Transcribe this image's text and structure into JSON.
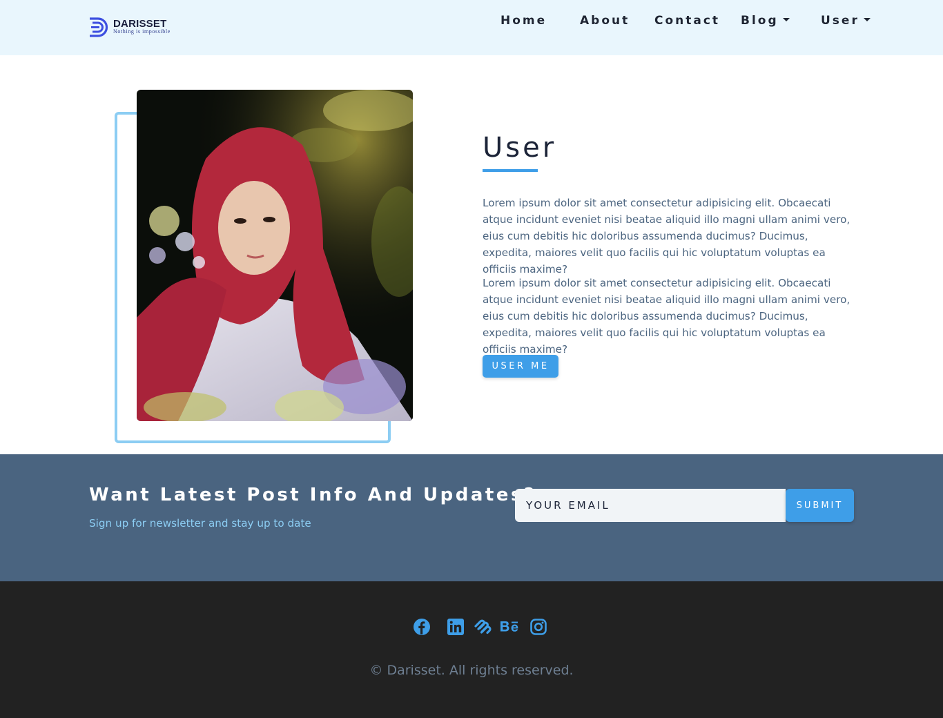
{
  "brand": {
    "name": "DARISSET",
    "tagline": "Nothing is impossible"
  },
  "nav": {
    "items": [
      {
        "label": "Home",
        "dropdown": false
      },
      {
        "label": "About",
        "dropdown": false
      },
      {
        "label": "Contact",
        "dropdown": false
      },
      {
        "label": "Blog",
        "dropdown": true
      },
      {
        "label": "User",
        "dropdown": true
      }
    ]
  },
  "about": {
    "title": "User",
    "paragraphs": [
      "Lorem ipsum dolor sit amet consectetur adipisicing elit. Obcaecati atque incidunt eveniet nisi beatae aliquid illo magni ullam animi vero, eius cum debitis hic doloribus assumenda ducimus? Ducimus, expedita, maiores velit quo facilis qui hic voluptatum voluptas ea officiis maxime?",
      "Lorem ipsum dolor sit amet consectetur adipisicing elit. Obcaecati atque incidunt eveniet nisi beatae aliquid illo magni ullam animi vero, eius cum debitis hic doloribus assumenda ducimus? Ducimus, expedita, maiores velit quo facilis qui hic voluptatum voluptas ea officiis maxime?"
    ],
    "button_label": "USER ME"
  },
  "newsletter": {
    "title": "Want Latest Post Info And Updates?",
    "subtitle": "Sign up for newsletter and stay up to date",
    "email_placeholder": "YOUR EMAIL",
    "submit_label": "SUBMIT"
  },
  "footer": {
    "social_icons": [
      "facebook-icon",
      "linkedin-icon",
      "squarespace-icon",
      "behance-icon",
      "instagram-icon"
    ],
    "copyright": "© Darisset. All rights reserved."
  },
  "colors": {
    "accent": "#3e9ee8",
    "navbar_bg": "#e9f6fd",
    "newsletter_bg": "#4a6480",
    "footer_bg": "#222222",
    "frame_border": "#8ccdf3"
  }
}
